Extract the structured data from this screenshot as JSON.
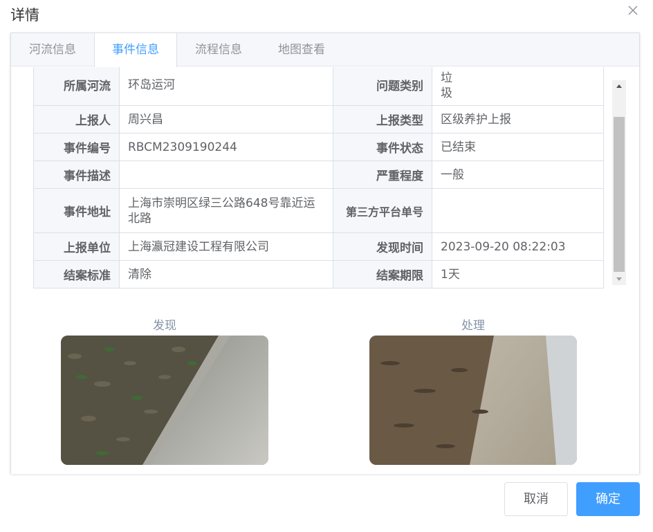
{
  "dialog": {
    "title": "详情",
    "close_icon": "close-icon"
  },
  "tabs": [
    {
      "label": "河流信息",
      "active": false
    },
    {
      "label": "事件信息",
      "active": true
    },
    {
      "label": "流程信息",
      "active": false
    },
    {
      "label": "地图查看",
      "active": false
    }
  ],
  "details": {
    "rows": [
      {
        "l1": "所属河流",
        "v1": "环岛运河",
        "l2": "问题类别",
        "v2": "垃圾"
      },
      {
        "l1": "上报人",
        "v1": "周兴昌",
        "l2": "上报类型",
        "v2": "区级养护上报"
      },
      {
        "l1": "事件编号",
        "v1": "RBCM2309190244",
        "l2": "事件状态",
        "v2": "已结束"
      },
      {
        "l1": "事件描述",
        "v1": "",
        "l2": "严重程度",
        "v2": "一般"
      },
      {
        "l1": "事件地址",
        "v1": "上海市崇明区绿三公路648号靠近运北路",
        "l2": "第三方平台单号",
        "v2": ""
      },
      {
        "l1": "上报单位",
        "v1": "上海瀛冠建设工程有限公司",
        "l2": "发现时间",
        "v2": "2023-09-20 08:22:03"
      },
      {
        "l1": "结案标准",
        "v1": "清除",
        "l2": "结案期限",
        "v2": "1天"
      }
    ]
  },
  "photos": {
    "found_label": "发现",
    "handled_label": "处理"
  },
  "footer": {
    "cancel_label": "取消",
    "ok_label": "确定"
  },
  "colors": {
    "accent": "#409eff",
    "label_bg": "#f5f7fa",
    "border": "#dcdfe6"
  }
}
